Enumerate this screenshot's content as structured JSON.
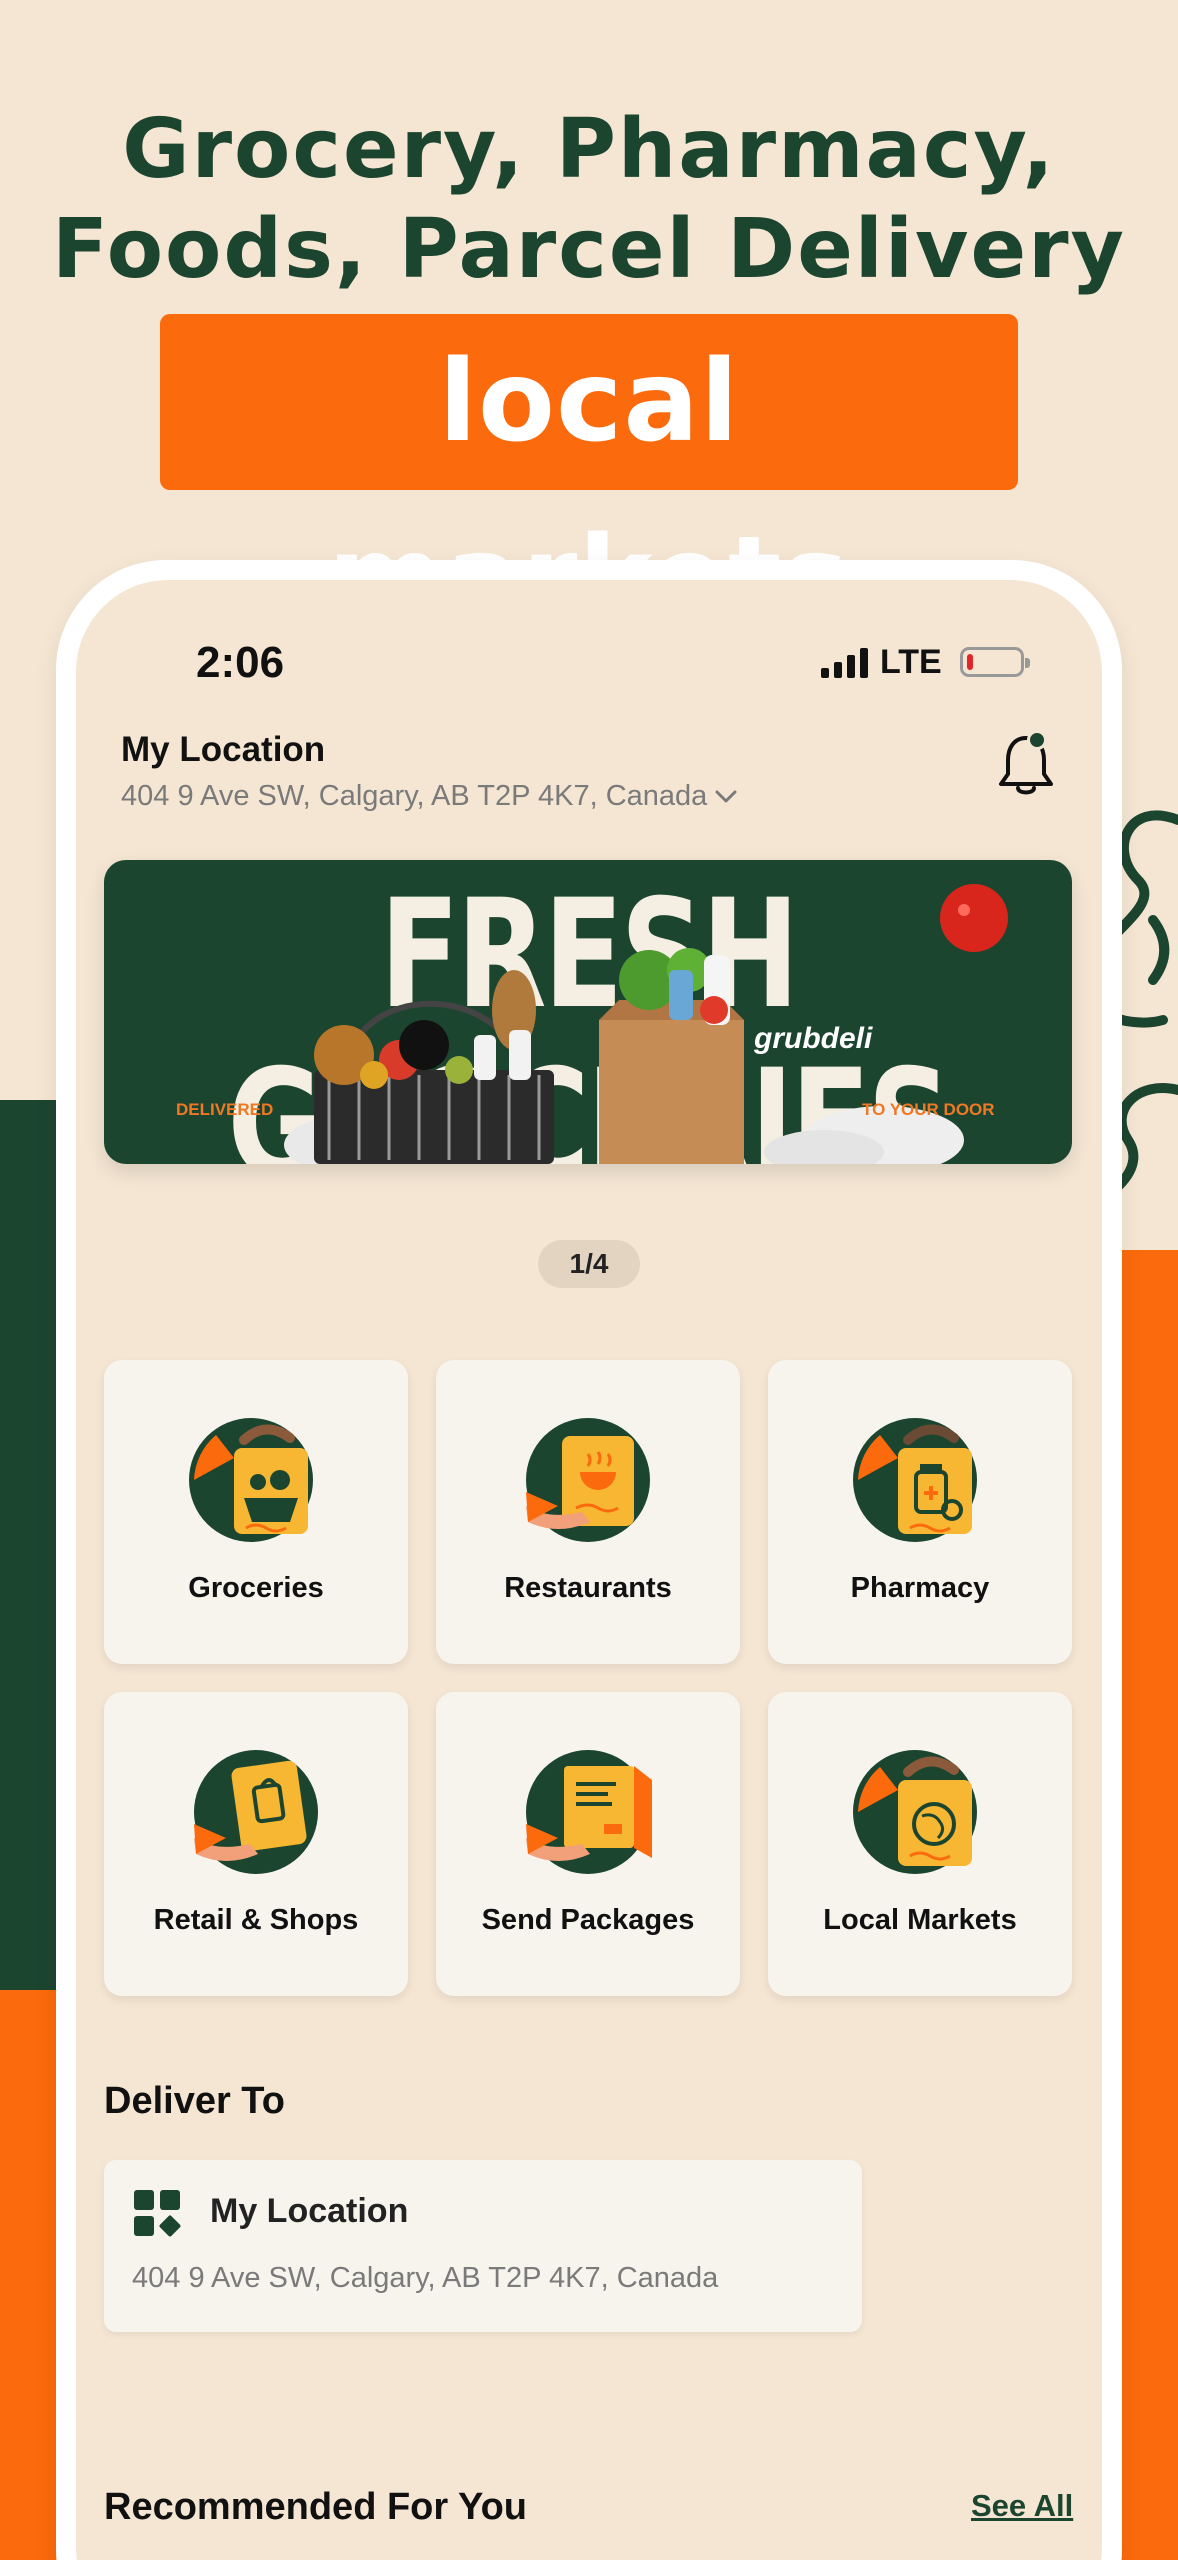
{
  "promo": {
    "headline_line1": "Grocery, Pharmacy,",
    "headline_line2": "Foods, Parcel Delivery",
    "highlight": "local markets"
  },
  "status_bar": {
    "time": "2:06",
    "network": "LTE",
    "battery_level": 0.1
  },
  "location": {
    "title": "My Location",
    "address": "404 9 Ave SW, Calgary, AB T2P 4K7, Canada"
  },
  "banner": {
    "title": "FRESH GROCERIES",
    "left_text": "DELIVERED",
    "right_text": "TO YOUR DOOR",
    "brand": "grubdeli",
    "pager": "1/4"
  },
  "categories": [
    {
      "label": "Groceries",
      "icon": "grocery-bag-icon"
    },
    {
      "label": "Restaurants",
      "icon": "restaurant-bag-icon"
    },
    {
      "label": "Pharmacy",
      "icon": "pharmacy-bag-icon"
    },
    {
      "label": "Retail & Shops",
      "icon": "shopping-bag-icon"
    },
    {
      "label": "Send Packages",
      "icon": "package-icon"
    },
    {
      "label": "Local Markets",
      "icon": "local-market-bag-icon"
    }
  ],
  "deliver_to": {
    "section_title": "Deliver To",
    "title": "My Location",
    "address": "404 9 Ave SW, Calgary, AB T2P 4K7, Canada",
    "icon": "location-grid-icon"
  },
  "recommended": {
    "section_title": "Recommended For You",
    "see_all": "See All"
  },
  "colors": {
    "brand_green": "#1c4530",
    "brand_orange": "#fb6a0c",
    "background": "#f5e6d3"
  }
}
